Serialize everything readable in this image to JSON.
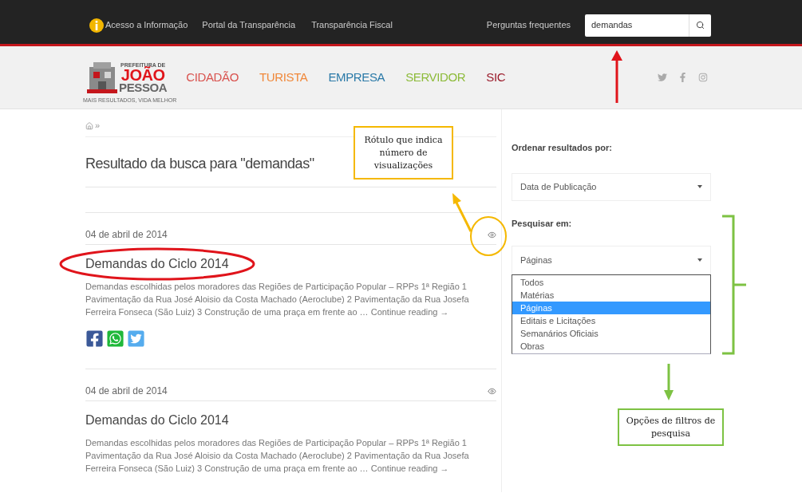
{
  "top_bar": {
    "links": [
      "Acesso a Informação",
      "Portal da Transparência",
      "Transparência Fiscal"
    ],
    "faq": "Perguntas frequentes",
    "search": {
      "value": "demandas"
    }
  },
  "header": {
    "logo": {
      "top": "PREFEITURA DE",
      "name": "JOÃO",
      "name2": "PESSOA",
      "slogan": "MAIS RESULTADOS, VIDA MELHOR"
    },
    "nav": [
      {
        "label": "CIDADÃO",
        "color": "#d9534f"
      },
      {
        "label": "TURISTA",
        "color": "#f0883a"
      },
      {
        "label": "EMPRESA",
        "color": "#2b7aa8"
      },
      {
        "label": "SERVIDOR",
        "color": "#8dbb3a"
      },
      {
        "label": "SIC",
        "color": "#9b1c2c"
      }
    ]
  },
  "breadcrumb": {
    "separator": "»"
  },
  "heading": "Resultado da busca para \"demandas\"",
  "posts": [
    {
      "date": "04 de abril de 2014",
      "title": "Demandas do Ciclo 2014",
      "excerpt": "Demandas escolhidas pelos moradores das Regiões de Participação Popular – RPPs 1ª Região 1 Pavimentação da Rua José Aloisio da Costa Machado (Aeroclube) 2 Pavimentação da Rua Josefa Ferreira Fonseca (São Luiz) 3 Construção de uma praça em frente ao …",
      "link": "Continue reading →",
      "share": true
    },
    {
      "date": "04 de abril de 2014",
      "title": "Demandas do Ciclo 2014",
      "excerpt": "Demandas escolhidas pelos moradores das Regiões de Participação Popular – RPPs 1ª Região 1 Pavimentação da Rua José Aloisio da Costa Machado (Aeroclube) 2 Pavimentação da Rua Josefa Ferreira Fonseca (São Luiz) 3 Construção de uma praça em frente ao …",
      "link": "Continue reading →",
      "share": false
    }
  ],
  "sidebar": {
    "sort": {
      "label": "Ordenar resultados por:",
      "value": "Data de Publicação"
    },
    "search_in": {
      "label": "Pesquisar em:",
      "value": "Páginas",
      "options": [
        {
          "label": "Todos",
          "selected": false
        },
        {
          "label": "Matérias",
          "selected": false
        },
        {
          "label": "Páginas",
          "selected": true
        },
        {
          "label": "Editais e Licitações",
          "selected": false
        },
        {
          "label": "Semanários Oficiais",
          "selected": false
        },
        {
          "label": "Obras",
          "selected": false
        }
      ]
    }
  },
  "annotations": [
    {
      "text": "Rótulo que indica número de visualizações",
      "color": "#f5b800"
    },
    {
      "text": "Opções de filtros de pesquisa",
      "color": "#7dc243"
    }
  ]
}
